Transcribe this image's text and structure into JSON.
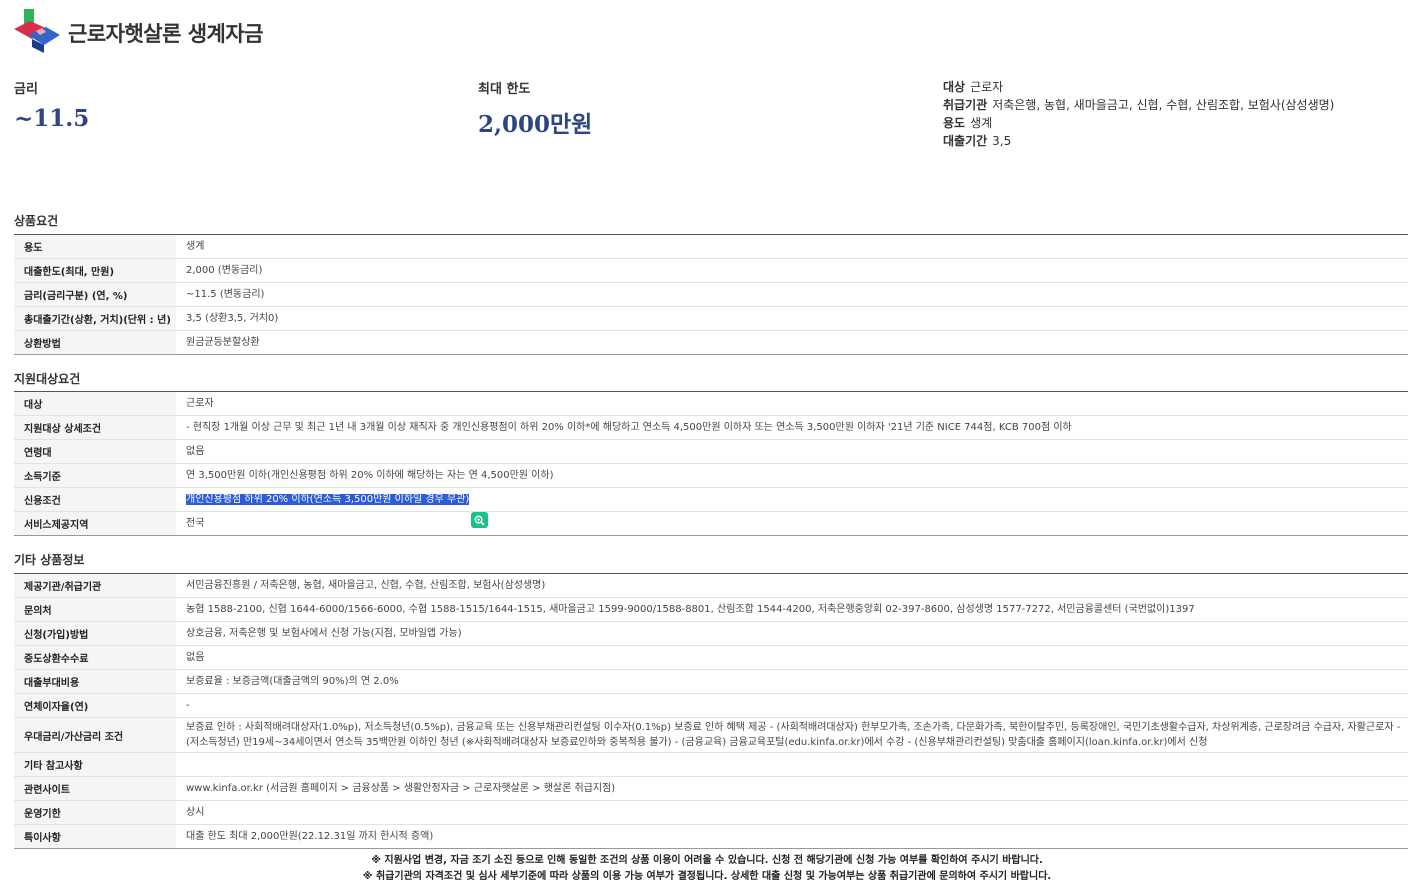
{
  "header": {
    "title": "근로자햇살론 생계자금"
  },
  "summary": {
    "rate_label": "금리",
    "rate_value": "~11.5",
    "limit_label": "최대 한도",
    "limit_value": "2,000만원",
    "info": [
      {
        "k": "대상",
        "v": "근로자"
      },
      {
        "k": "취급기관",
        "v": "저축은행, 농협, 새마을금고, 신협, 수협, 산림조합, 보험사(삼성생명)"
      },
      {
        "k": "용도",
        "v": "생계"
      },
      {
        "k": "대출기간",
        "v": "3,5"
      }
    ]
  },
  "sections": {
    "product": {
      "title": "상품요건",
      "rows": [
        {
          "k": "용도",
          "v": "생계"
        },
        {
          "k": "대출한도(최대, 만원)",
          "v": "2,000 (변동금리)"
        },
        {
          "k": "금리(금리구분) (연, %)",
          "v": "~11.5 (변동금리)"
        },
        {
          "k": "총대출기간(상환, 거치)(단위 : 년)",
          "v": "3,5 (상환3,5, 거치0)"
        },
        {
          "k": "상환방법",
          "v": "원금균등분할상환"
        }
      ]
    },
    "target": {
      "title": "지원대상요건",
      "rows": [
        {
          "k": "대상",
          "v": "근로자"
        },
        {
          "k": "지원대상 상세조건",
          "v": "- 현직장 1개월 이상 근무 및 최근 1년 내 3개월 이상 재직자 중 개인신용평점이 하위 20% 이하*에 해당하고 연소득 4,500만원 이하자 또는 연소득 3,500만원 이하자 '21년 기준 NICE 744점, KCB 700점 이하"
        },
        {
          "k": "연령대",
          "v": "없음"
        },
        {
          "k": "소득기준",
          "v": "연 3,500만원 이하(개인신용평점 하위 20% 이하에 해당하는 자는 연 4,500만원 이하)"
        },
        {
          "k": "신용조건",
          "v": "개인신용평점 하위 20% 이하(연소득 3,500만원 이하일 경우 무관)"
        },
        {
          "k": "서비스제공지역",
          "v": "전국"
        }
      ]
    },
    "etc": {
      "title": "기타 상품정보",
      "rows": [
        {
          "k": "제공기관/취급기관",
          "v": "서민금융진흥원 / 저축은행, 농협, 새마을금고, 신협, 수협, 산림조합, 보험사(삼성생명)"
        },
        {
          "k": "문의처",
          "v": "농협 1588-2100, 신협 1644-6000/1566-6000, 수협 1588-1515/1644-1515, 새마을금고 1599-9000/1588-8801, 산림조합 1544-4200, 저축은행중앙회 02-397-8600, 삼성생명 1577-7272, 서민금융콜센터 (국번없이)1397"
        },
        {
          "k": "신청(가입)방법",
          "v": "상호금융, 저축은행 및 보험사에서 신청 가능(지점, 모바일앱 가능)"
        },
        {
          "k": "중도상환수수료",
          "v": "없음"
        },
        {
          "k": "대출부대비용",
          "v": "보증료율 : 보증금액(대출금액의 90%)의 연 2.0%"
        },
        {
          "k": "연체이자율(연)",
          "v": "-"
        },
        {
          "k": "우대금리/가산금리 조건",
          "v": "보증료 인하 : 사회적배려대상자(1.0%p), 저소득청년(0.5%p), 금융교육 또는 신용부채관리컨설팅 이수자(0.1%p) 보증료 인하 혜택 제공 - (사회적배려대상자) 한부모가족, 조손가족, 다문화가족, 북한이탈주민, 등록장애인, 국민기초생활수급자, 차상위계층, 근로장려금 수급자, 자활근로자 - (저소득청년) 만19세~34세이면서 연소득 35백만원 이하인 청년 (※사회적배려대상자 보증료인하와 중복적용 불가) - (금융교육) 금융교육포털(edu.kinfa.or.kr)에서 수강 - (신용부채관리컨설팅) 맞춤대출 홈페이지(loan.kinfa.or.kr)에서 신청"
        },
        {
          "k": "기타 참고사항",
          "v": ""
        },
        {
          "k": "관련사이트",
          "v": "www.kinfa.or.kr (서금원 홈페이지 > 금융상품 > 생활안정자금 > 근로자햇살론 > 햇살론 취급지점)"
        },
        {
          "k": "운영기한",
          "v": "상시"
        },
        {
          "k": "특이사항",
          "v": "대출 한도 최대 2,000만원(22.12.31일 까지 한시적 증액)"
        }
      ]
    }
  },
  "notices": [
    "※ 지원사업 변경, 자금 조기 소진 등으로 인해 동일한 조건의 상품 이용이 어려울 수 있습니다. 신청 전 해당기관에 신청 가능 여부를 확인하여 주시기 바랍니다.",
    "※ 취급기관의 자격조건 및 심사 세부기준에 따라 상품의 이용 가능 여부가 결정됩니다. 상세한 대출 신청 및 가능여부는 상품 취급기관에 문의하여 주시기 바랍니다."
  ],
  "icons": {
    "logo": "brand-logo-icon",
    "search": "search-zoom-icon"
  },
  "colors": {
    "accent_value": "#2f4583",
    "highlight": "#2e5cd6",
    "badge": "#19c28a"
  }
}
